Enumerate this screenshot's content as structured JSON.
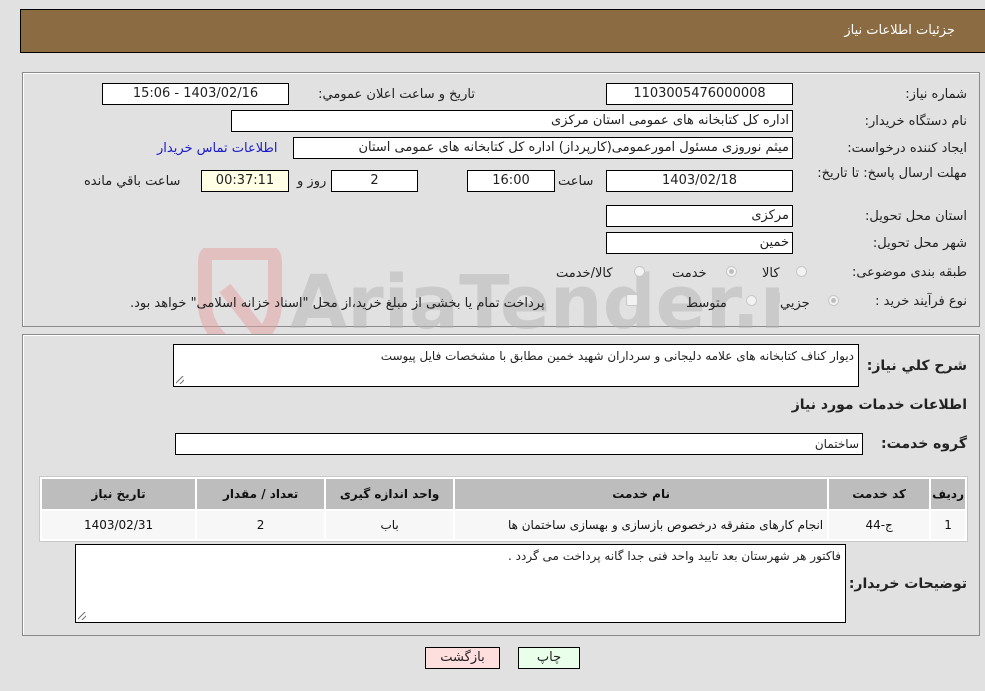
{
  "header": {
    "title": "جزئیات اطلاعات نیاز"
  },
  "details": {
    "need_number": {
      "label": "شماره نیاز:",
      "value": "1103005476000008"
    },
    "announce_datetime": {
      "label": "تاریخ و ساعت اعلان عمومي:",
      "value": "1403/02/16 - 15:06"
    },
    "buyer_org": {
      "label": "نام دستگاه خریدار:",
      "value": "اداره کل کتابخانه های عمومی استان مرکزی"
    },
    "requester": {
      "label": "ایجاد کننده درخواست:",
      "value": "میثم نوروزی مسئول امورعمومی(کارپرداز) اداره کل کتابخانه های عمومی استان",
      "contact_link": "اطلاعات تماس خریدار"
    },
    "deadline": {
      "label": "مهلت ارسال پاسخ: تا تاریخ:",
      "date": "1403/02/18",
      "time_label": "ساعت",
      "time": "16:00",
      "days": "2",
      "days_label": "روز و",
      "remaining": "00:37:11",
      "remaining_label": "ساعت باقي مانده"
    },
    "delivery_province": {
      "label": "استان محل تحویل:",
      "value": "مرکزی"
    },
    "delivery_city": {
      "label": "شهر محل تحویل:",
      "value": "خمین"
    },
    "category": {
      "label": "طبقه بندی موضوعی:",
      "options": [
        {
          "label": "کالا",
          "selected": false
        },
        {
          "label": "خدمت",
          "selected": true
        },
        {
          "label": "کالا/خدمت",
          "selected": false
        }
      ]
    },
    "purchase_process": {
      "label": "نوع فرآیند خرید :",
      "options": [
        {
          "label": "جزیي",
          "selected": true
        },
        {
          "label": "متوسط",
          "selected": false
        }
      ],
      "checkbox_label": "پرداخت تمام یا بخشی از مبلغ خرید،از محل \"اسناد خزانه اسلامی\" خواهد بود."
    }
  },
  "need_description": {
    "label": "شرح کلي نياز:",
    "value": "دیوار کناف کتابخانه های علامه دلیجانی و سرداران شهید خمین مطابق با مشخصات فایل پیوست"
  },
  "services_section": {
    "title": "اطلاعات خدمات مورد نياز"
  },
  "service_group": {
    "label": "گروه خدمت:",
    "value": "ساختمان"
  },
  "services_table": {
    "columns": [
      "ردیف",
      "کد خدمت",
      "نام خدمت",
      "واحد اندازه گیری",
      "تعداد / مقدار",
      "تاریخ نیاز"
    ],
    "rows": [
      [
        "1",
        "ج-44",
        "انجام کارهای متفرقه درخصوص بازسازی و بهسازی ساختمان ها",
        "باب",
        "2",
        "1403/02/31"
      ]
    ]
  },
  "buyer_notes": {
    "label": "توضیحات خریدار:",
    "value": "فاکتور هر شهرستان بعد تایید واحد فنی جدا گانه پرداخت می گردد ."
  },
  "buttons": {
    "print": "چاپ",
    "back": "بازگشت"
  },
  "watermark": {
    "text": "AriaTender.neT"
  },
  "colors": {
    "header_bg": "#8b6c42",
    "print_bg": "#eaffea",
    "back_bg": "#ffdede",
    "link": "#1a1acc"
  }
}
